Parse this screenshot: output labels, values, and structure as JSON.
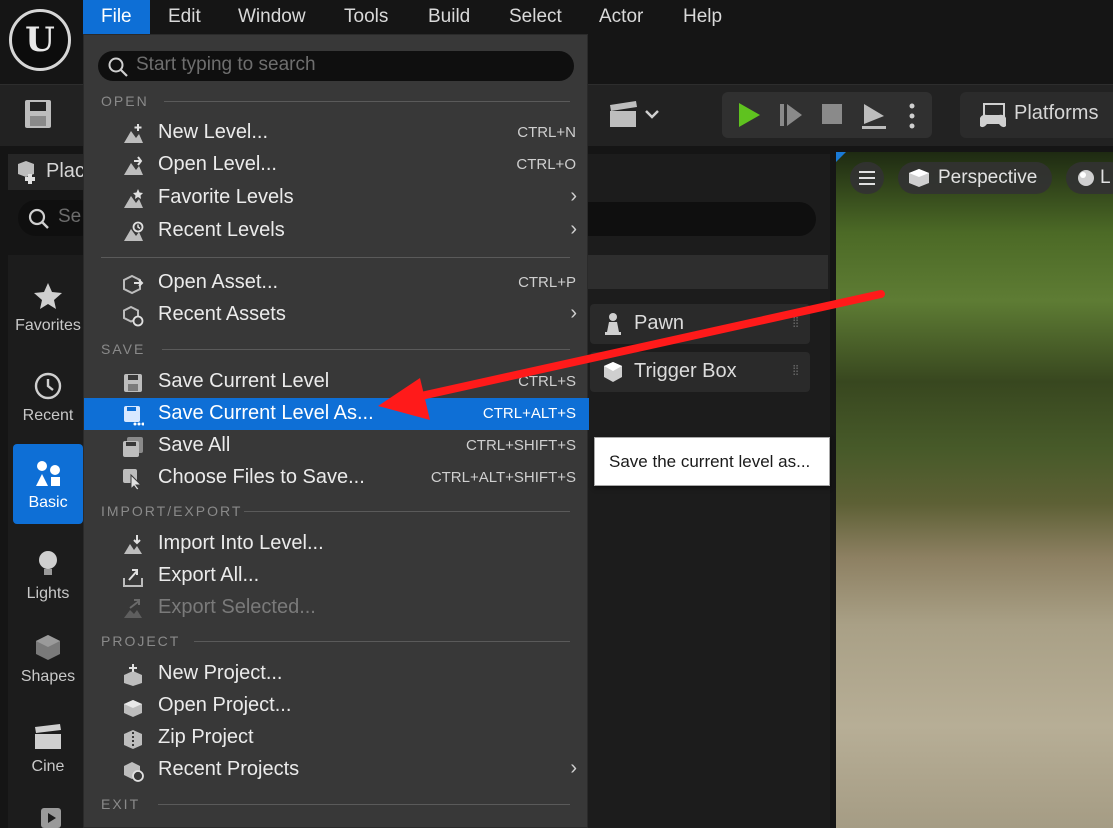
{
  "menubar": {
    "logo_letter": "U",
    "items": [
      "File",
      "Edit",
      "Window",
      "Tools",
      "Build",
      "Select",
      "Actor",
      "Help"
    ]
  },
  "toolbar": {
    "platforms_label": "Platforms"
  },
  "place_actors": {
    "title": "Plac",
    "search_placeholder": "Se",
    "categories": [
      {
        "label": "Favorites",
        "icon": "star-icon"
      },
      {
        "label": "Recent",
        "icon": "clock-icon"
      },
      {
        "label": "Basic",
        "icon": "basic-shapes-icon",
        "active": true
      },
      {
        "label": "Lights",
        "icon": "lightbulb-icon"
      },
      {
        "label": "Shapes",
        "icon": "cube-icon"
      },
      {
        "label": "Cine",
        "icon": "clapperboard-icon"
      }
    ],
    "items": [
      {
        "label": "Pawn",
        "icon": "pawn-icon"
      },
      {
        "label": "Trigger Box",
        "icon": "trigger-box-icon"
      }
    ]
  },
  "viewport": {
    "mode_label": "Perspective",
    "lit_label": "L"
  },
  "tooltip": {
    "text": "Save the current level as..."
  },
  "file_menu": {
    "search_placeholder": "Start typing to search",
    "sections": {
      "open": "OPEN",
      "save": "SAVE",
      "import_export": "IMPORT/EXPORT",
      "project": "PROJECT",
      "exit": "EXIT"
    },
    "open_items": [
      {
        "label": "New Level...",
        "shortcut": "CTRL+N"
      },
      {
        "label": "Open Level...",
        "shortcut": "CTRL+O"
      },
      {
        "label": "Favorite Levels",
        "submenu": true
      },
      {
        "label": "Recent Levels",
        "submenu": true
      },
      {
        "label": "Open Asset...",
        "shortcut": "CTRL+P"
      },
      {
        "label": "Recent Assets",
        "submenu": true
      }
    ],
    "save_items": [
      {
        "label": "Save Current Level",
        "shortcut": "CTRL+S"
      },
      {
        "label": "Save Current Level As...",
        "shortcut": "CTRL+ALT+S",
        "highlighted": true
      },
      {
        "label": "Save All",
        "shortcut": "CTRL+SHIFT+S"
      },
      {
        "label": "Choose Files to Save...",
        "shortcut": "CTRL+ALT+SHIFT+S"
      }
    ],
    "import_export_items": [
      {
        "label": "Import Into Level..."
      },
      {
        "label": "Export All..."
      },
      {
        "label": "Export Selected...",
        "disabled": true
      }
    ],
    "project_items": [
      {
        "label": "New Project..."
      },
      {
        "label": "Open Project..."
      },
      {
        "label": "Zip Project"
      },
      {
        "label": "Recent Projects",
        "submenu": true
      }
    ]
  },
  "colors": {
    "accent": "#0e6fd6",
    "play_green": "#5fc21f",
    "annotation_arrow": "#ff1a1a"
  }
}
